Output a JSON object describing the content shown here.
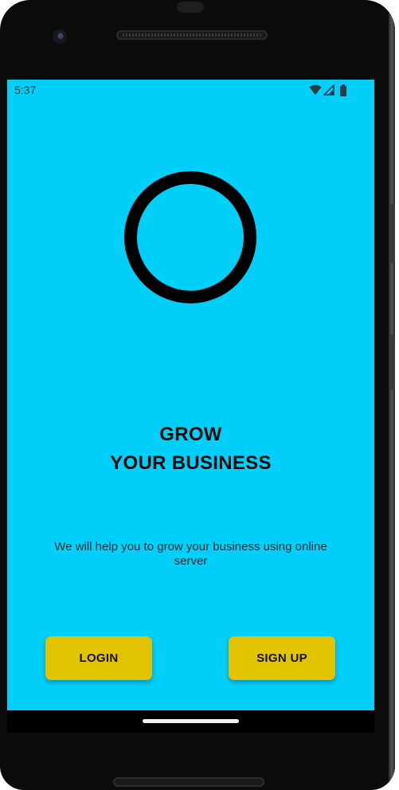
{
  "status_bar": {
    "time": "5:37",
    "icons": [
      "wifi-icon",
      "cell-signal-icon",
      "battery-icon"
    ]
  },
  "logo": {
    "icon": "circle-logo-icon",
    "color": "#000000"
  },
  "headline": {
    "line1": "GROW",
    "line2": "YOUR BUSINESS"
  },
  "tagline": "We will help you to grow your business using online server",
  "buttons": {
    "login_label": "LOGIN",
    "signup_label": "SIGN UP"
  },
  "colors": {
    "background": "#00cffa",
    "button": "#e2c300",
    "text": "#0a0a0a"
  }
}
